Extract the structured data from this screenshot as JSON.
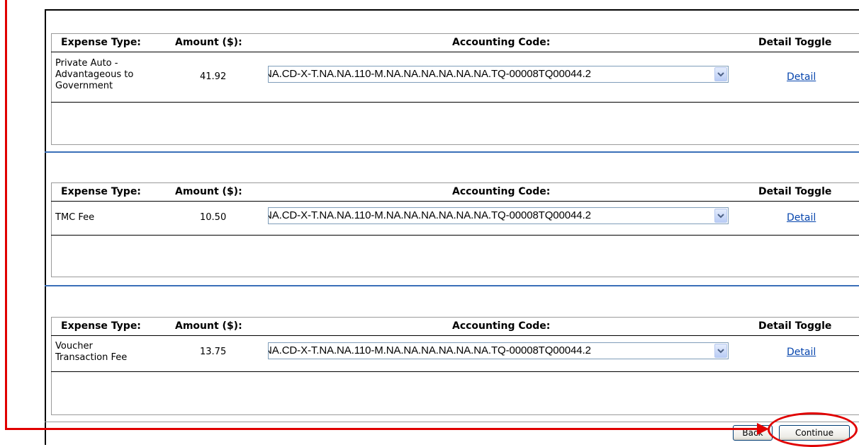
{
  "headers": {
    "expense_type": "Expense Type:",
    "amount": "Amount ($):",
    "accounting_code": "Accounting Code:",
    "detail_toggle": "Detail Toggle"
  },
  "expenses": [
    {
      "expense_type": "Private Auto -\nAdvantageous to\nGovernment",
      "amount": "41.92",
      "accounting_code": "NA.CD-X-T.NA.NA.110-M.NA.NA.NA.NA.NA.NA.TQ-00008TQ00044.2",
      "detail_label": "Detail"
    },
    {
      "expense_type": "TMC Fee",
      "amount": "10.50",
      "accounting_code": "NA.CD-X-T.NA.NA.110-M.NA.NA.NA.NA.NA.NA.TQ-00008TQ00044.2",
      "detail_label": "Detail"
    },
    {
      "expense_type": "Voucher\nTransaction Fee",
      "amount": "13.75",
      "accounting_code": "NA.CD-X-T.NA.NA.110-M.NA.NA.NA.NA.NA.NA.TQ-00008TQ00044.2",
      "detail_label": "Detail"
    }
  ],
  "buttons": {
    "back": "Back",
    "continue": "Continue"
  },
  "colors": {
    "annotation": "#e00000",
    "link": "#0645ad",
    "separator": "#3a6fb8"
  }
}
